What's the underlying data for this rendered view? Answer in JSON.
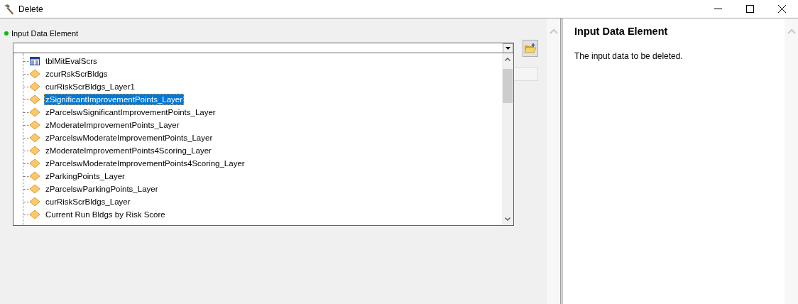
{
  "window": {
    "title": "Delete"
  },
  "parameter": {
    "label": "Input Data Element",
    "required": true
  },
  "dropdown": {
    "items": [
      {
        "label": "tblMitEvalScrs",
        "kind": "table",
        "selected": false
      },
      {
        "label": "zcurRskScrBldgs",
        "kind": "layer",
        "selected": false
      },
      {
        "label": "curRiskScrBldgs_Layer1",
        "kind": "layer",
        "selected": false
      },
      {
        "label": "zSignificantImprovementPoints_Layer",
        "kind": "layer",
        "selected": true
      },
      {
        "label": "zParcelswSignificantImprovementPoints_Layer",
        "kind": "layer",
        "selected": false
      },
      {
        "label": "zModerateImprovementPoints_Layer",
        "kind": "layer",
        "selected": false
      },
      {
        "label": "zParcelswModerateImprovementPoints_Layer",
        "kind": "layer",
        "selected": false
      },
      {
        "label": "zModerateImprovementPoints4Scoring_Layer",
        "kind": "layer",
        "selected": false
      },
      {
        "label": "zParcelswModerateImprovementPoints4Scoring_Layer",
        "kind": "layer",
        "selected": false
      },
      {
        "label": "zParkingPoints_Layer",
        "kind": "layer",
        "selected": false
      },
      {
        "label": "zParcelswParkingPoints_Layer",
        "kind": "layer",
        "selected": false
      },
      {
        "label": "curRiskScrBldgs_Layer",
        "kind": "layer",
        "selected": false
      },
      {
        "label": "Current Run Bldgs by Risk Score",
        "kind": "layer",
        "selected": false
      }
    ]
  },
  "help": {
    "title": "Input Data Element",
    "text": "The input data to be deleted."
  }
}
